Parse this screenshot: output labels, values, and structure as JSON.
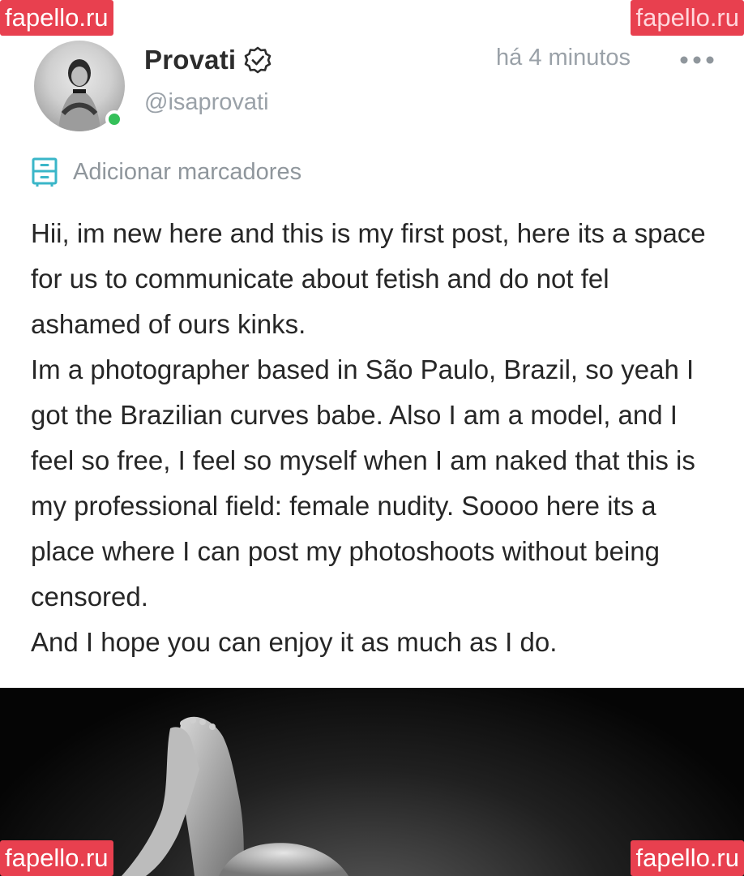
{
  "watermarks": {
    "top_left": "fapello.ru",
    "top_right": "fapello.ru",
    "bottom_left": "fapello.ru",
    "bottom_right": "fapello.ru"
  },
  "author": {
    "name": "Provati",
    "handle": "@isaprovati",
    "verified_icon": "verified-badge-icon",
    "online": true,
    "online_color": "#35c05a"
  },
  "post": {
    "timestamp": "há 4 minutos",
    "more_icon": "more-horizontal-icon",
    "bookmark_label": "Adicionar marcadores",
    "bookmark_icon": "bookmark-list-icon",
    "bookmark_color": "#3ab6c8",
    "paragraphs": [
      "Hii, im new here and this is my first post, here its a space for us to communicate about fetish and do not fel ashamed of ours kinks.",
      "Im a photographer based in São Paulo, Brazil, so yeah I got the Brazilian curves babe. Also I am a model, and I feel so free, I feel so myself when I am naked that this is my professional field: female nudity. Soooo here its a place where I can post my photoshoots without being censored.",
      "And I hope you can enjoy it as much as I do."
    ]
  },
  "colors": {
    "watermark_bg": "#e8404f",
    "text_primary": "#262626",
    "text_muted": "#9aa1a8"
  }
}
